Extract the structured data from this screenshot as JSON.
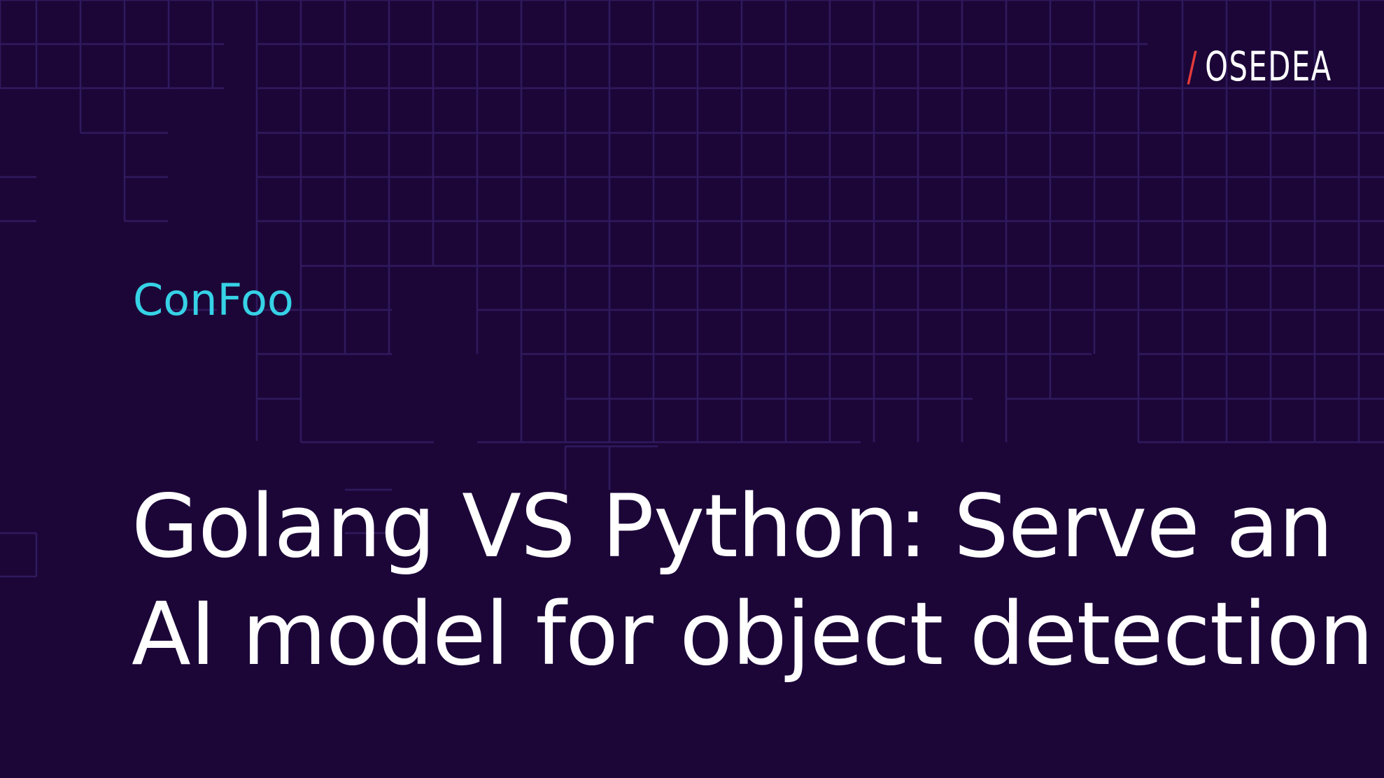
{
  "brand": {
    "slash": "/",
    "name": "OSEDEA",
    "accent_color": "#e53b3b"
  },
  "event": {
    "name": "ConFoo",
    "color": "#36d2e6"
  },
  "title": {
    "line1": "Golang VS Python: Serve an",
    "line2": "AI model for object detection"
  },
  "theme": {
    "background": "#1c0638",
    "grid_line": "#301a5e",
    "text": "#ffffff"
  }
}
